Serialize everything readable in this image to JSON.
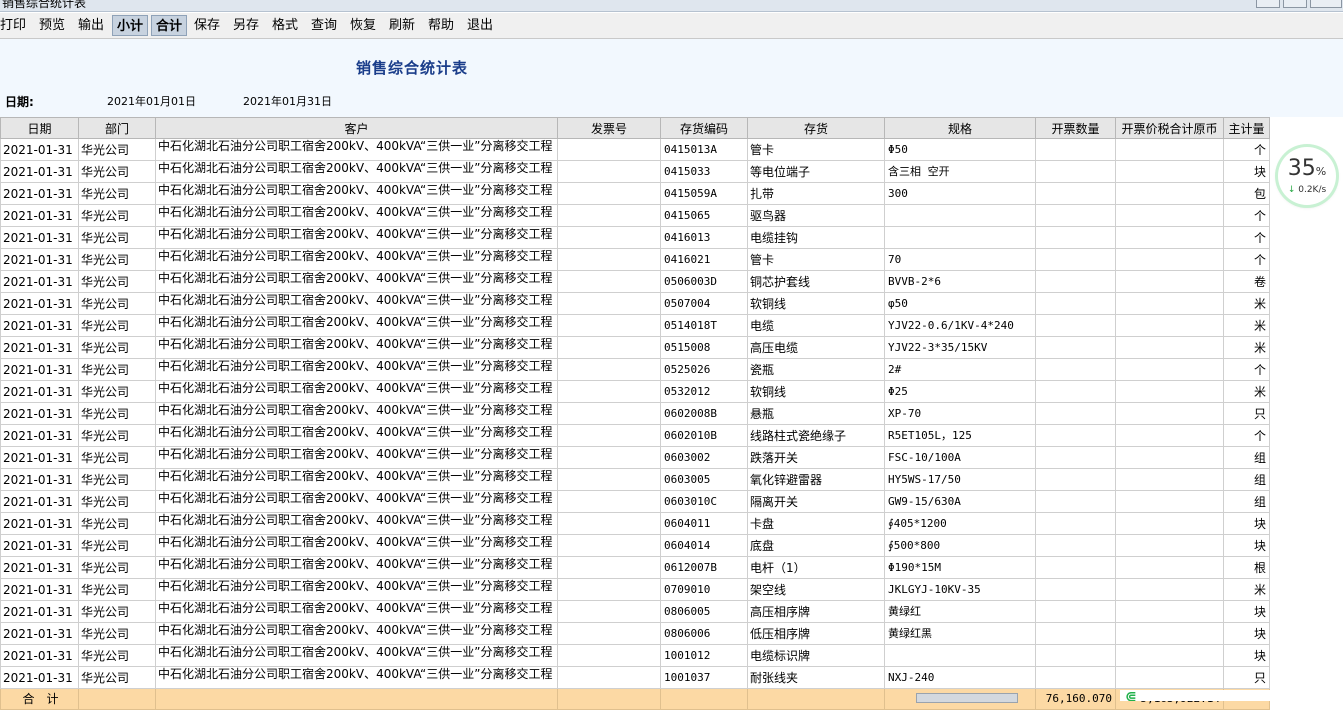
{
  "window": {
    "title": "销售综合统计表"
  },
  "menu": [
    {
      "label": "打印",
      "pressed": false
    },
    {
      "label": "预览",
      "pressed": false
    },
    {
      "label": "输出",
      "pressed": false
    },
    {
      "label": "小计",
      "pressed": true
    },
    {
      "label": "合计",
      "pressed": true
    },
    {
      "label": "保存",
      "pressed": false
    },
    {
      "label": "另存",
      "pressed": false
    },
    {
      "label": "格式",
      "pressed": false
    },
    {
      "label": "查询",
      "pressed": false
    },
    {
      "label": "恢复",
      "pressed": false
    },
    {
      "label": "刷新",
      "pressed": false
    },
    {
      "label": "帮助",
      "pressed": false
    },
    {
      "label": "退出",
      "pressed": false
    }
  ],
  "report": {
    "title": "销售综合统计表",
    "date_label": "日期:",
    "date_from": "2021年01月01日",
    "date_to": "2021年01月31日"
  },
  "table": {
    "columns": [
      "日期",
      "部门",
      "客户",
      "发票号",
      "存货编码",
      "存货",
      "规格",
      "开票数量",
      "开票价税合计原币",
      "主计量"
    ],
    "customer": "中石化湖北石油分公司职工宿舍200kV、400kVA“三供一业”分离移交工程",
    "rows": [
      {
        "date": "2021-01-31",
        "dept": "华光公司",
        "invoice": "",
        "code": "0415013A",
        "item": "管卡",
        "spec": "Φ50",
        "qty": "",
        "amount": "",
        "unit": "个"
      },
      {
        "date": "2021-01-31",
        "dept": "华光公司",
        "invoice": "",
        "code": "0415033",
        "item": "等电位端子",
        "spec": "含三相 空开",
        "qty": "",
        "amount": "",
        "unit": "块"
      },
      {
        "date": "2021-01-31",
        "dept": "华光公司",
        "invoice": "",
        "code": "0415059A",
        "item": "扎带",
        "spec": "300",
        "qty": "",
        "amount": "",
        "unit": "包"
      },
      {
        "date": "2021-01-31",
        "dept": "华光公司",
        "invoice": "",
        "code": "0415065",
        "item": "驱鸟器",
        "spec": "",
        "qty": "",
        "amount": "",
        "unit": "个"
      },
      {
        "date": "2021-01-31",
        "dept": "华光公司",
        "invoice": "",
        "code": "0416013",
        "item": "电缆挂钩",
        "spec": "",
        "qty": "",
        "amount": "",
        "unit": "个"
      },
      {
        "date": "2021-01-31",
        "dept": "华光公司",
        "invoice": "",
        "code": "0416021",
        "item": "管卡",
        "spec": "70",
        "qty": "",
        "amount": "",
        "unit": "个"
      },
      {
        "date": "2021-01-31",
        "dept": "华光公司",
        "invoice": "",
        "code": "0506003D",
        "item": "铜芯护套线",
        "spec": "BVVB-2*6",
        "qty": "",
        "amount": "",
        "unit": "卷"
      },
      {
        "date": "2021-01-31",
        "dept": "华光公司",
        "invoice": "",
        "code": "0507004",
        "item": "软铜线",
        "spec": "φ50",
        "qty": "",
        "amount": "",
        "unit": "米"
      },
      {
        "date": "2021-01-31",
        "dept": "华光公司",
        "invoice": "",
        "code": "0514018T",
        "item": "电缆",
        "spec": "YJV22-0.6/1KV-4*240",
        "qty": "",
        "amount": "",
        "unit": "米"
      },
      {
        "date": "2021-01-31",
        "dept": "华光公司",
        "invoice": "",
        "code": "0515008",
        "item": "高压电缆",
        "spec": "YJV22-3*35/15KV",
        "qty": "",
        "amount": "",
        "unit": "米"
      },
      {
        "date": "2021-01-31",
        "dept": "华光公司",
        "invoice": "",
        "code": "0525026",
        "item": "瓷瓶",
        "spec": "2#",
        "qty": "",
        "amount": "",
        "unit": "个"
      },
      {
        "date": "2021-01-31",
        "dept": "华光公司",
        "invoice": "",
        "code": "0532012",
        "item": "软铜线",
        "spec": "Φ25",
        "qty": "",
        "amount": "",
        "unit": "米"
      },
      {
        "date": "2021-01-31",
        "dept": "华光公司",
        "invoice": "",
        "code": "0602008B",
        "item": "悬瓶",
        "spec": "XP-70",
        "qty": "",
        "amount": "",
        "unit": "只"
      },
      {
        "date": "2021-01-31",
        "dept": "华光公司",
        "invoice": "",
        "code": "0602010B",
        "item": "线路柱式瓷绝缘子",
        "spec": "R5ET105L，125",
        "qty": "",
        "amount": "",
        "unit": "个"
      },
      {
        "date": "2021-01-31",
        "dept": "华光公司",
        "invoice": "",
        "code": "0603002",
        "item": "跌落开关",
        "spec": "FSC-10/100A",
        "qty": "",
        "amount": "",
        "unit": "组"
      },
      {
        "date": "2021-01-31",
        "dept": "华光公司",
        "invoice": "",
        "code": "0603005",
        "item": "氧化锌避雷器",
        "spec": "HY5WS-17/50",
        "qty": "",
        "amount": "",
        "unit": "组"
      },
      {
        "date": "2021-01-31",
        "dept": "华光公司",
        "invoice": "",
        "code": "0603010C",
        "item": "隔离开关",
        "spec": "GW9-15/630A",
        "qty": "",
        "amount": "",
        "unit": "组"
      },
      {
        "date": "2021-01-31",
        "dept": "华光公司",
        "invoice": "",
        "code": "0604011",
        "item": "卡盘",
        "spec": "∮405*1200",
        "qty": "",
        "amount": "",
        "unit": "块"
      },
      {
        "date": "2021-01-31",
        "dept": "华光公司",
        "invoice": "",
        "code": "0604014",
        "item": "底盘",
        "spec": "∮500*800",
        "qty": "",
        "amount": "",
        "unit": "块"
      },
      {
        "date": "2021-01-31",
        "dept": "华光公司",
        "invoice": "",
        "code": "0612007B",
        "item": "电杆（1）",
        "spec": "Φ190*15M",
        "qty": "",
        "amount": "",
        "unit": "根"
      },
      {
        "date": "2021-01-31",
        "dept": "华光公司",
        "invoice": "",
        "code": "0709010",
        "item": "架空线",
        "spec": "JKLGYJ-10KV-35",
        "qty": "",
        "amount": "",
        "unit": "米"
      },
      {
        "date": "2021-01-31",
        "dept": "华光公司",
        "invoice": "",
        "code": "0806005",
        "item": "高压相序牌",
        "spec": "黄绿红",
        "qty": "",
        "amount": "",
        "unit": "块"
      },
      {
        "date": "2021-01-31",
        "dept": "华光公司",
        "invoice": "",
        "code": "0806006",
        "item": "低压相序牌",
        "spec": "黄绿红黑",
        "qty": "",
        "amount": "",
        "unit": "块"
      },
      {
        "date": "2021-01-31",
        "dept": "华光公司",
        "invoice": "",
        "code": "1001012",
        "item": "电缆标识牌",
        "spec": "",
        "qty": "",
        "amount": "",
        "unit": "块"
      },
      {
        "date": "2021-01-31",
        "dept": "华光公司",
        "invoice": "",
        "code": "1001037",
        "item": "耐张线夹",
        "spec": "NXJ-240",
        "qty": "",
        "amount": "",
        "unit": "只"
      }
    ],
    "total": {
      "label": "合　计",
      "qty": "76,160.070",
      "amount": "5,163,922.14"
    }
  },
  "speed_widget": {
    "percent": "35",
    "percent_unit": "%",
    "rate": "0.2K/s"
  },
  "colors": {
    "header_bg": "#f2f8fe",
    "total_bg": "#fcd9a4",
    "title_color": "#1a3d8a"
  }
}
